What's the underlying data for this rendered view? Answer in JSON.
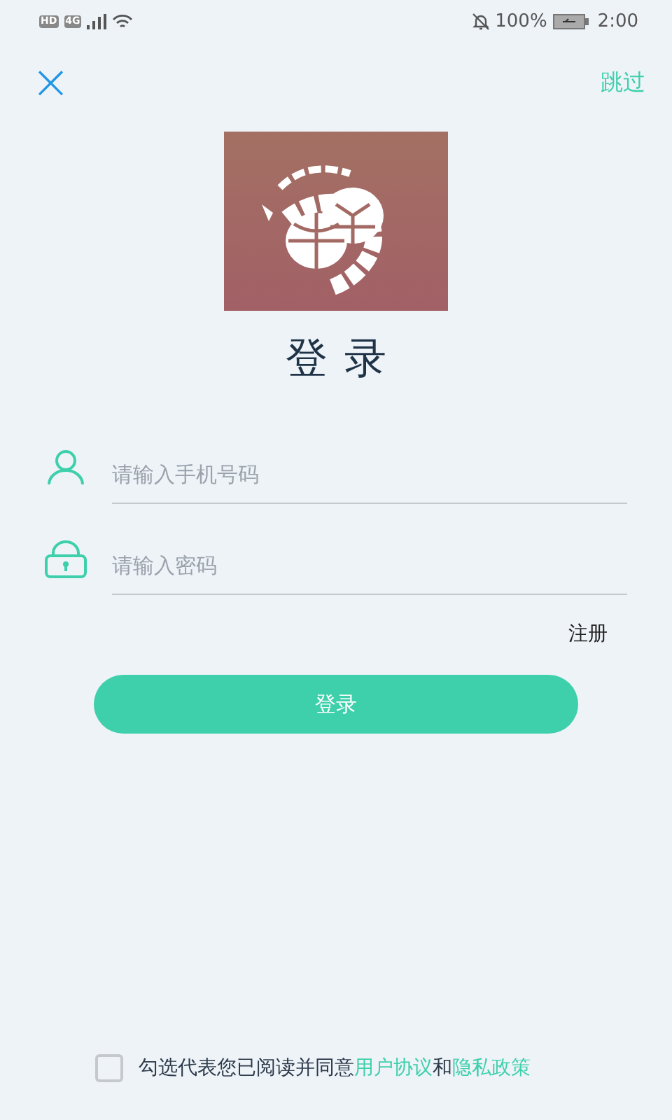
{
  "status_bar": {
    "network_badges": [
      "HD",
      "4G"
    ],
    "battery": "100%",
    "time": "2:00"
  },
  "top_bar": {
    "close": "×",
    "skip": "跳过"
  },
  "title": "登录",
  "fields": [
    {
      "kind": "phone",
      "placeholder": "请输入手机号码"
    },
    {
      "kind": "password",
      "placeholder": "请输入密码"
    }
  ],
  "register_link": "注册",
  "login_button": "登录",
  "agreement": {
    "checked": false,
    "text": "勾选代表您已阅读并同意",
    "links": [
      "用户协议",
      "隐私政策"
    ],
    "joiner": "和"
  }
}
